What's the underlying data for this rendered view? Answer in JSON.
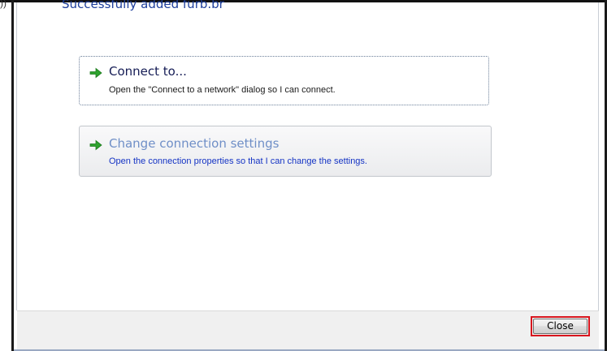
{
  "header": {
    "corner_mark": "))",
    "message": "Successfully added furb.br"
  },
  "options": [
    {
      "title": "Connect to...",
      "description": "Open the \"Connect to a network\" dialog so I can connect.",
      "icon": "green-arrow-icon",
      "state": "focused"
    },
    {
      "title": "Change connection settings",
      "description": "Open the connection properties so that I can change the settings.",
      "icon": "green-arrow-icon",
      "state": "hover"
    }
  ],
  "footer": {
    "close_label": "Close",
    "highlight_color": "#d8161e"
  },
  "colors": {
    "heading": "#1e3f9c",
    "link_title": "#151c55",
    "link_title_hover": "#6f8fc7",
    "link_desc_hover": "#1433c4",
    "arrow": "#2ea32e"
  }
}
